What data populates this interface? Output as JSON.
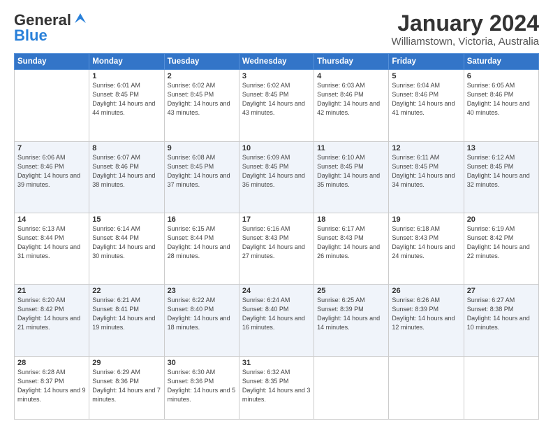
{
  "logo": {
    "line1": "General",
    "line2": "Blue"
  },
  "title": "January 2024",
  "subtitle": "Williamstown, Victoria, Australia",
  "weekdays": [
    "Sunday",
    "Monday",
    "Tuesday",
    "Wednesday",
    "Thursday",
    "Friday",
    "Saturday"
  ],
  "weeks": [
    [
      {
        "day": "",
        "sunrise": "",
        "sunset": "",
        "daylight": ""
      },
      {
        "day": "1",
        "sunrise": "Sunrise: 6:01 AM",
        "sunset": "Sunset: 8:45 PM",
        "daylight": "Daylight: 14 hours and 44 minutes."
      },
      {
        "day": "2",
        "sunrise": "Sunrise: 6:02 AM",
        "sunset": "Sunset: 8:45 PM",
        "daylight": "Daylight: 14 hours and 43 minutes."
      },
      {
        "day": "3",
        "sunrise": "Sunrise: 6:02 AM",
        "sunset": "Sunset: 8:45 PM",
        "daylight": "Daylight: 14 hours and 43 minutes."
      },
      {
        "day": "4",
        "sunrise": "Sunrise: 6:03 AM",
        "sunset": "Sunset: 8:46 PM",
        "daylight": "Daylight: 14 hours and 42 minutes."
      },
      {
        "day": "5",
        "sunrise": "Sunrise: 6:04 AM",
        "sunset": "Sunset: 8:46 PM",
        "daylight": "Daylight: 14 hours and 41 minutes."
      },
      {
        "day": "6",
        "sunrise": "Sunrise: 6:05 AM",
        "sunset": "Sunset: 8:46 PM",
        "daylight": "Daylight: 14 hours and 40 minutes."
      }
    ],
    [
      {
        "day": "7",
        "sunrise": "Sunrise: 6:06 AM",
        "sunset": "Sunset: 8:46 PM",
        "daylight": "Daylight: 14 hours and 39 minutes."
      },
      {
        "day": "8",
        "sunrise": "Sunrise: 6:07 AM",
        "sunset": "Sunset: 8:46 PM",
        "daylight": "Daylight: 14 hours and 38 minutes."
      },
      {
        "day": "9",
        "sunrise": "Sunrise: 6:08 AM",
        "sunset": "Sunset: 8:45 PM",
        "daylight": "Daylight: 14 hours and 37 minutes."
      },
      {
        "day": "10",
        "sunrise": "Sunrise: 6:09 AM",
        "sunset": "Sunset: 8:45 PM",
        "daylight": "Daylight: 14 hours and 36 minutes."
      },
      {
        "day": "11",
        "sunrise": "Sunrise: 6:10 AM",
        "sunset": "Sunset: 8:45 PM",
        "daylight": "Daylight: 14 hours and 35 minutes."
      },
      {
        "day": "12",
        "sunrise": "Sunrise: 6:11 AM",
        "sunset": "Sunset: 8:45 PM",
        "daylight": "Daylight: 14 hours and 34 minutes."
      },
      {
        "day": "13",
        "sunrise": "Sunrise: 6:12 AM",
        "sunset": "Sunset: 8:45 PM",
        "daylight": "Daylight: 14 hours and 32 minutes."
      }
    ],
    [
      {
        "day": "14",
        "sunrise": "Sunrise: 6:13 AM",
        "sunset": "Sunset: 8:44 PM",
        "daylight": "Daylight: 14 hours and 31 minutes."
      },
      {
        "day": "15",
        "sunrise": "Sunrise: 6:14 AM",
        "sunset": "Sunset: 8:44 PM",
        "daylight": "Daylight: 14 hours and 30 minutes."
      },
      {
        "day": "16",
        "sunrise": "Sunrise: 6:15 AM",
        "sunset": "Sunset: 8:44 PM",
        "daylight": "Daylight: 14 hours and 28 minutes."
      },
      {
        "day": "17",
        "sunrise": "Sunrise: 6:16 AM",
        "sunset": "Sunset: 8:43 PM",
        "daylight": "Daylight: 14 hours and 27 minutes."
      },
      {
        "day": "18",
        "sunrise": "Sunrise: 6:17 AM",
        "sunset": "Sunset: 8:43 PM",
        "daylight": "Daylight: 14 hours and 26 minutes."
      },
      {
        "day": "19",
        "sunrise": "Sunrise: 6:18 AM",
        "sunset": "Sunset: 8:43 PM",
        "daylight": "Daylight: 14 hours and 24 minutes."
      },
      {
        "day": "20",
        "sunrise": "Sunrise: 6:19 AM",
        "sunset": "Sunset: 8:42 PM",
        "daylight": "Daylight: 14 hours and 22 minutes."
      }
    ],
    [
      {
        "day": "21",
        "sunrise": "Sunrise: 6:20 AM",
        "sunset": "Sunset: 8:42 PM",
        "daylight": "Daylight: 14 hours and 21 minutes."
      },
      {
        "day": "22",
        "sunrise": "Sunrise: 6:21 AM",
        "sunset": "Sunset: 8:41 PM",
        "daylight": "Daylight: 14 hours and 19 minutes."
      },
      {
        "day": "23",
        "sunrise": "Sunrise: 6:22 AM",
        "sunset": "Sunset: 8:40 PM",
        "daylight": "Daylight: 14 hours and 18 minutes."
      },
      {
        "day": "24",
        "sunrise": "Sunrise: 6:24 AM",
        "sunset": "Sunset: 8:40 PM",
        "daylight": "Daylight: 14 hours and 16 minutes."
      },
      {
        "day": "25",
        "sunrise": "Sunrise: 6:25 AM",
        "sunset": "Sunset: 8:39 PM",
        "daylight": "Daylight: 14 hours and 14 minutes."
      },
      {
        "day": "26",
        "sunrise": "Sunrise: 6:26 AM",
        "sunset": "Sunset: 8:39 PM",
        "daylight": "Daylight: 14 hours and 12 minutes."
      },
      {
        "day": "27",
        "sunrise": "Sunrise: 6:27 AM",
        "sunset": "Sunset: 8:38 PM",
        "daylight": "Daylight: 14 hours and 10 minutes."
      }
    ],
    [
      {
        "day": "28",
        "sunrise": "Sunrise: 6:28 AM",
        "sunset": "Sunset: 8:37 PM",
        "daylight": "Daylight: 14 hours and 9 minutes."
      },
      {
        "day": "29",
        "sunrise": "Sunrise: 6:29 AM",
        "sunset": "Sunset: 8:36 PM",
        "daylight": "Daylight: 14 hours and 7 minutes."
      },
      {
        "day": "30",
        "sunrise": "Sunrise: 6:30 AM",
        "sunset": "Sunset: 8:36 PM",
        "daylight": "Daylight: 14 hours and 5 minutes."
      },
      {
        "day": "31",
        "sunrise": "Sunrise: 6:32 AM",
        "sunset": "Sunset: 8:35 PM",
        "daylight": "Daylight: 14 hours and 3 minutes."
      },
      {
        "day": "",
        "sunrise": "",
        "sunset": "",
        "daylight": ""
      },
      {
        "day": "",
        "sunrise": "",
        "sunset": "",
        "daylight": ""
      },
      {
        "day": "",
        "sunrise": "",
        "sunset": "",
        "daylight": ""
      }
    ]
  ]
}
